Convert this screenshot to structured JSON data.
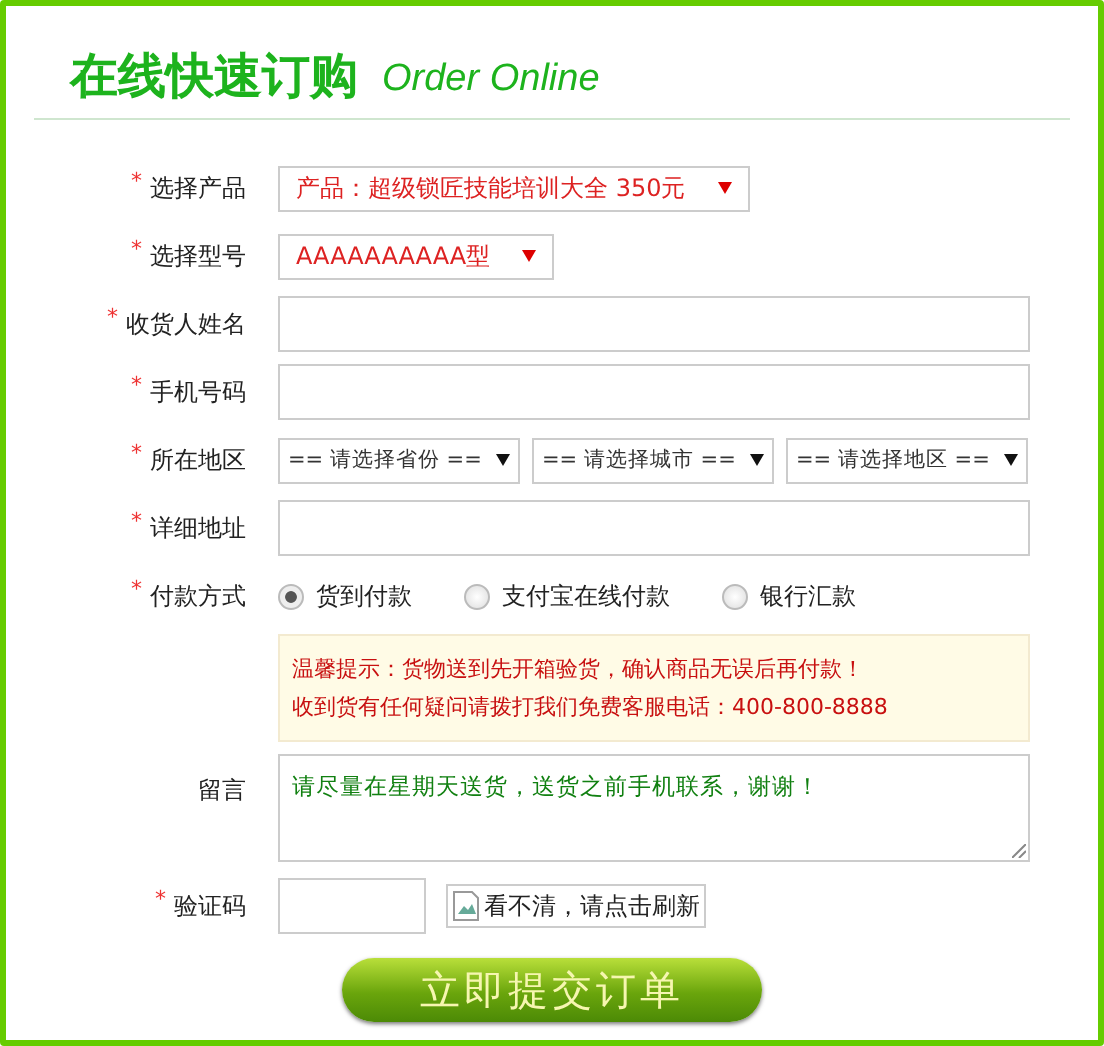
{
  "title": "在线快速订购",
  "subtitle": "Order Online",
  "fields": [
    {
      "kind": "select",
      "mark": "*",
      "label": "选择产品",
      "value": "产品：超级锁匠技能培训大全 350元"
    },
    {
      "kind": "select",
      "mark": "*",
      "label": "选择型号",
      "value": "AAAAAAAAAA型"
    },
    {
      "kind": "text",
      "mark": "*",
      "label": "收货人姓名"
    },
    {
      "kind": "text",
      "mark": "*",
      "label": "手机号码"
    },
    {
      "kind": "region",
      "mark": "*",
      "label": "所在地区",
      "options": [
        "== 请选择省份 ==",
        "== 请选择城市 ==",
        "== 请选择地区 =="
      ]
    },
    {
      "kind": "text",
      "mark": "*",
      "label": "详细地址"
    },
    {
      "kind": "radio",
      "mark": "*",
      "label": "付款方式",
      "choices": [
        {
          "label": "货到付款",
          "selected": true
        },
        {
          "label": "支付宝在线付款",
          "selected": false
        },
        {
          "label": "银行汇款",
          "selected": false
        }
      ]
    },
    {
      "kind": "notice",
      "lines": [
        "温馨提示：货物送到先开箱验货，确认商品无误后再付款！",
        "收到货有任何疑问请拨打我们免费客服电话：400-800-8888"
      ]
    },
    {
      "kind": "textarea",
      "label": "留言",
      "value": "请尽量在星期天送货，送货之前手机联系，谢谢！"
    },
    {
      "kind": "captcha",
      "mark": "*",
      "label": "验证码",
      "image_alt": "看不清，请点击刷新"
    }
  ],
  "submit": "立即提交订单"
}
